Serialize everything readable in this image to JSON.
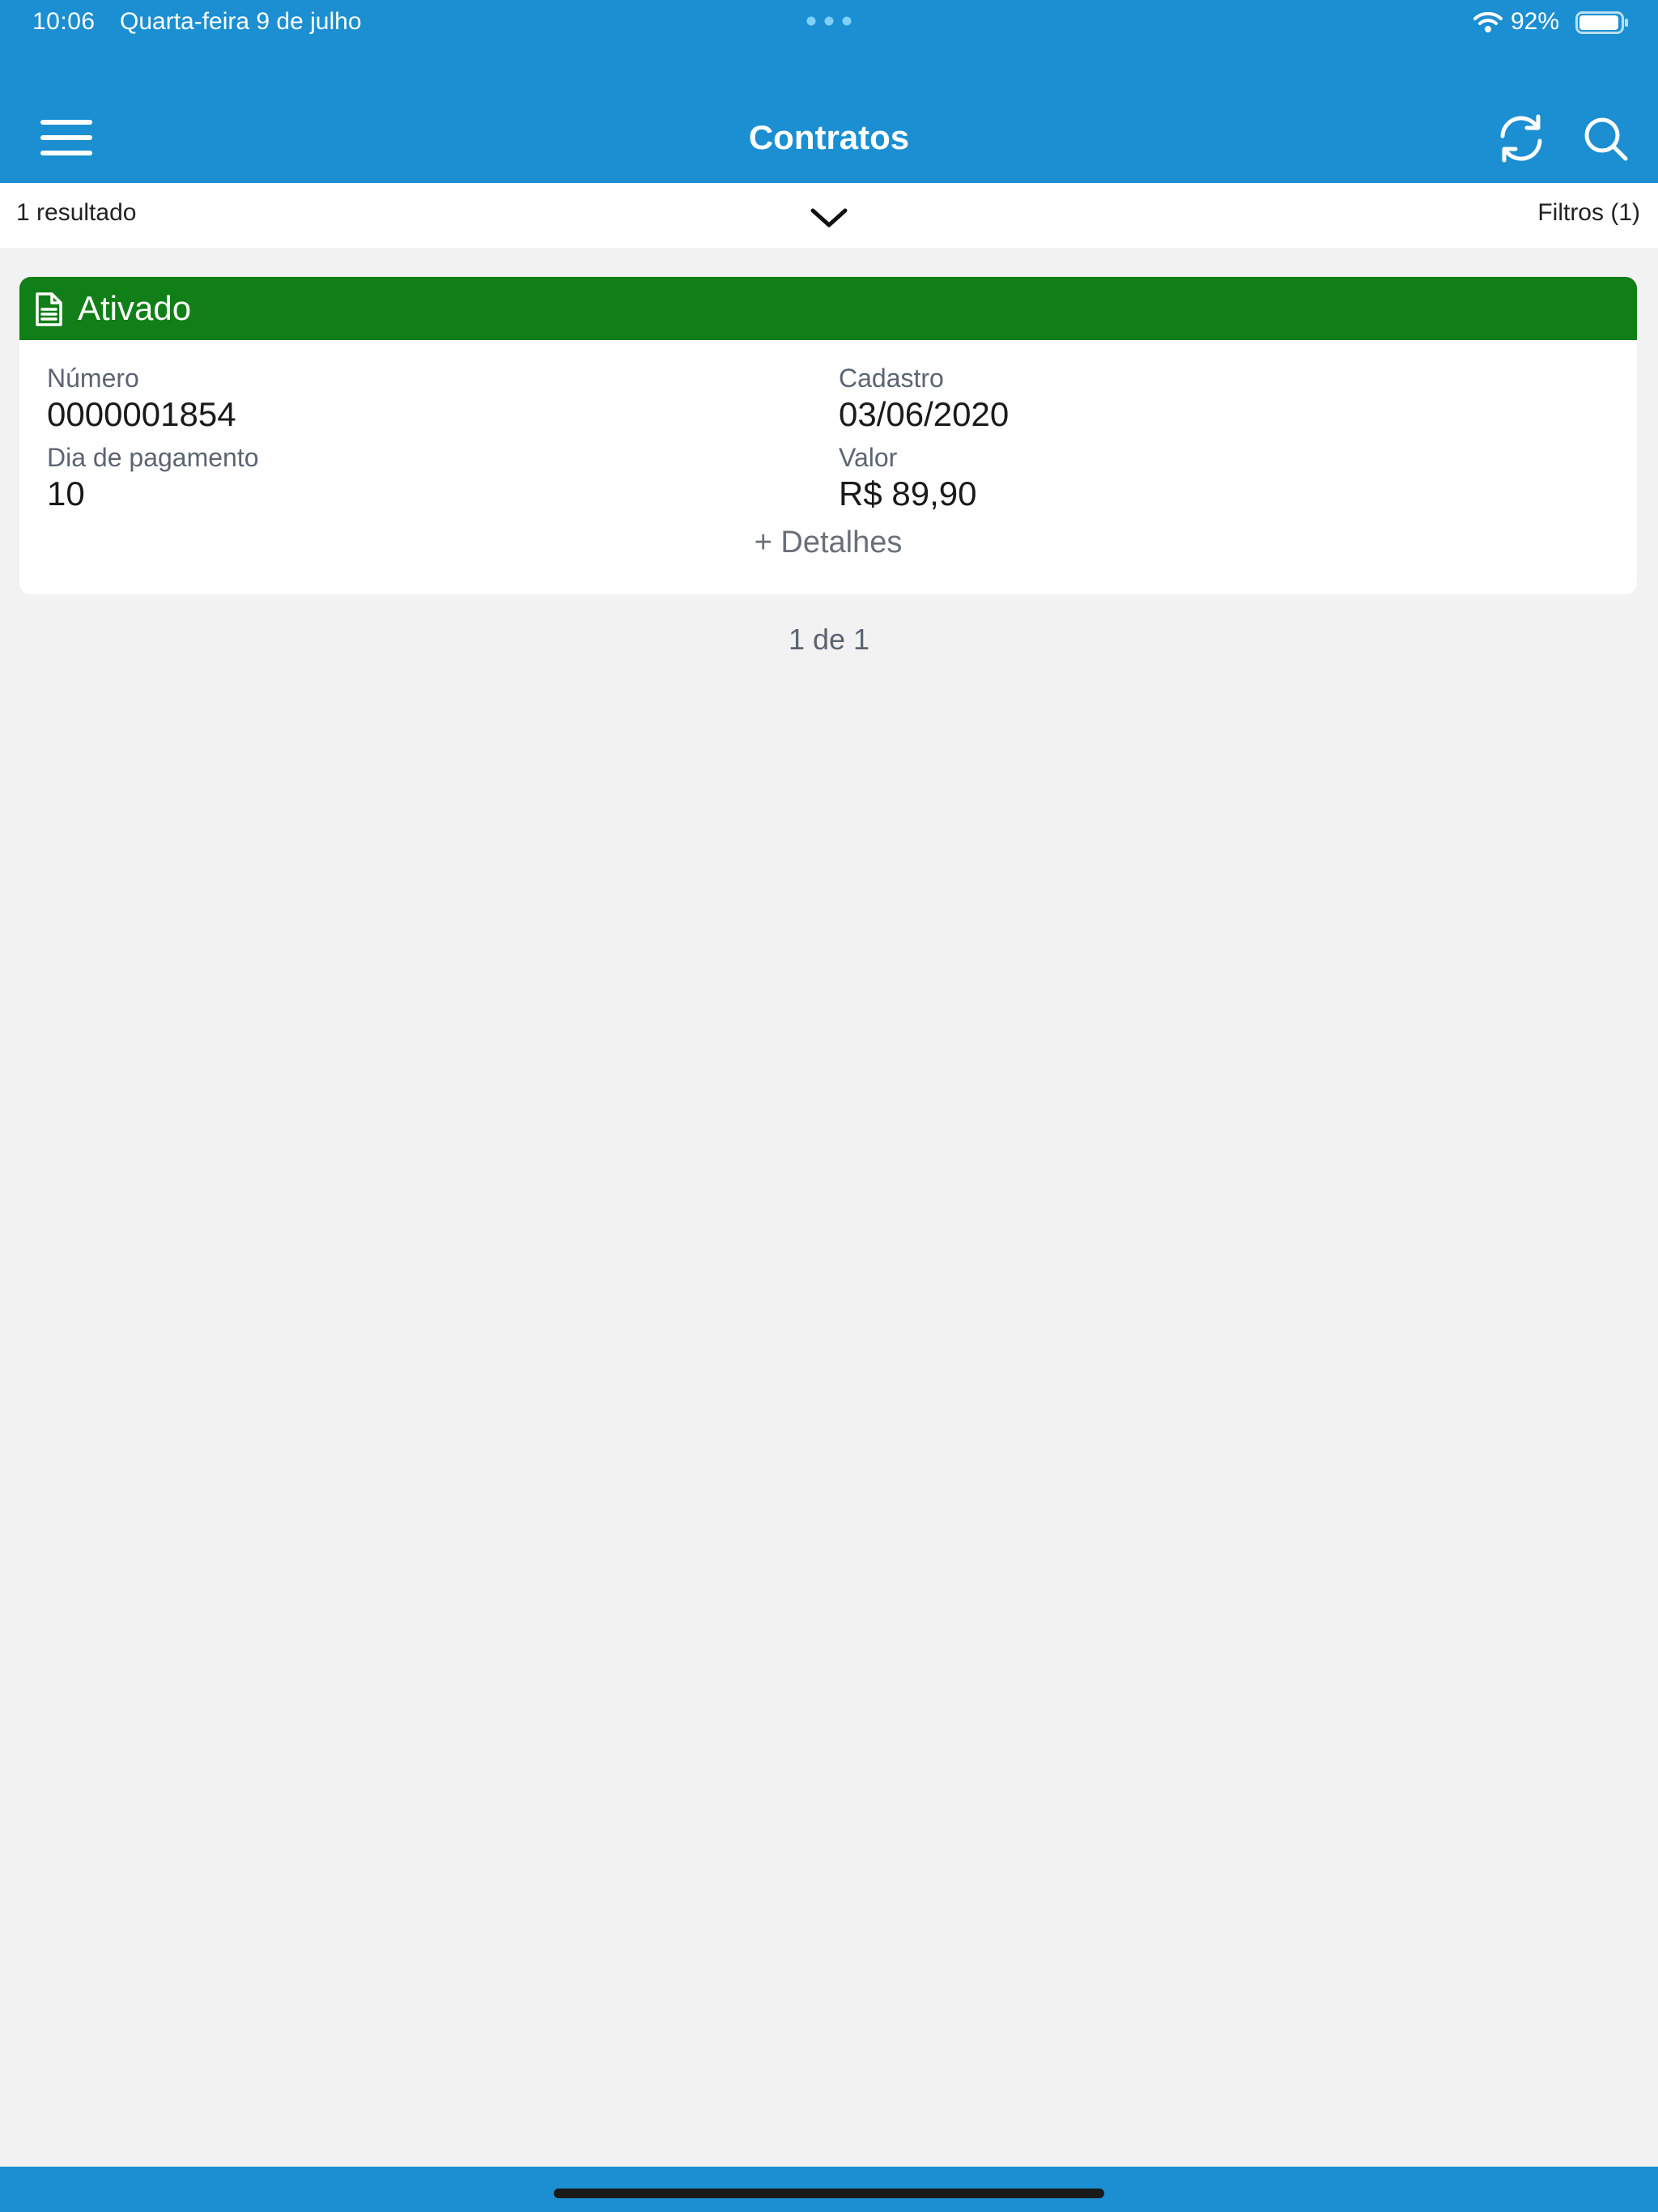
{
  "status_bar": {
    "time": "10:06",
    "date": "Quarta-feira 9 de julho",
    "battery": "92%"
  },
  "header": {
    "title": "Contratos",
    "icons": {
      "menu": "hamburger-menu-icon",
      "refresh": "refresh-icon",
      "search": "search-icon"
    }
  },
  "results": {
    "count_text": "1 resultado",
    "filters_label": "Filtros (1)"
  },
  "contract": {
    "status": "Ativado",
    "status_color": "#117f17",
    "fields": {
      "numero_label": "Número",
      "numero_value": "0000001854",
      "cadastro_label": "Cadastro",
      "cadastro_value": "03/06/2020",
      "dia_label": "Dia de pagamento",
      "dia_value": "10",
      "valor_label": "Valor",
      "valor_value": "R$ 89,90"
    },
    "details_label": "+ Detalhes"
  },
  "pagination": {
    "text": "1 de 1"
  },
  "theme": {
    "primary": "#1b8fd2",
    "background": "#f2f2f2"
  }
}
